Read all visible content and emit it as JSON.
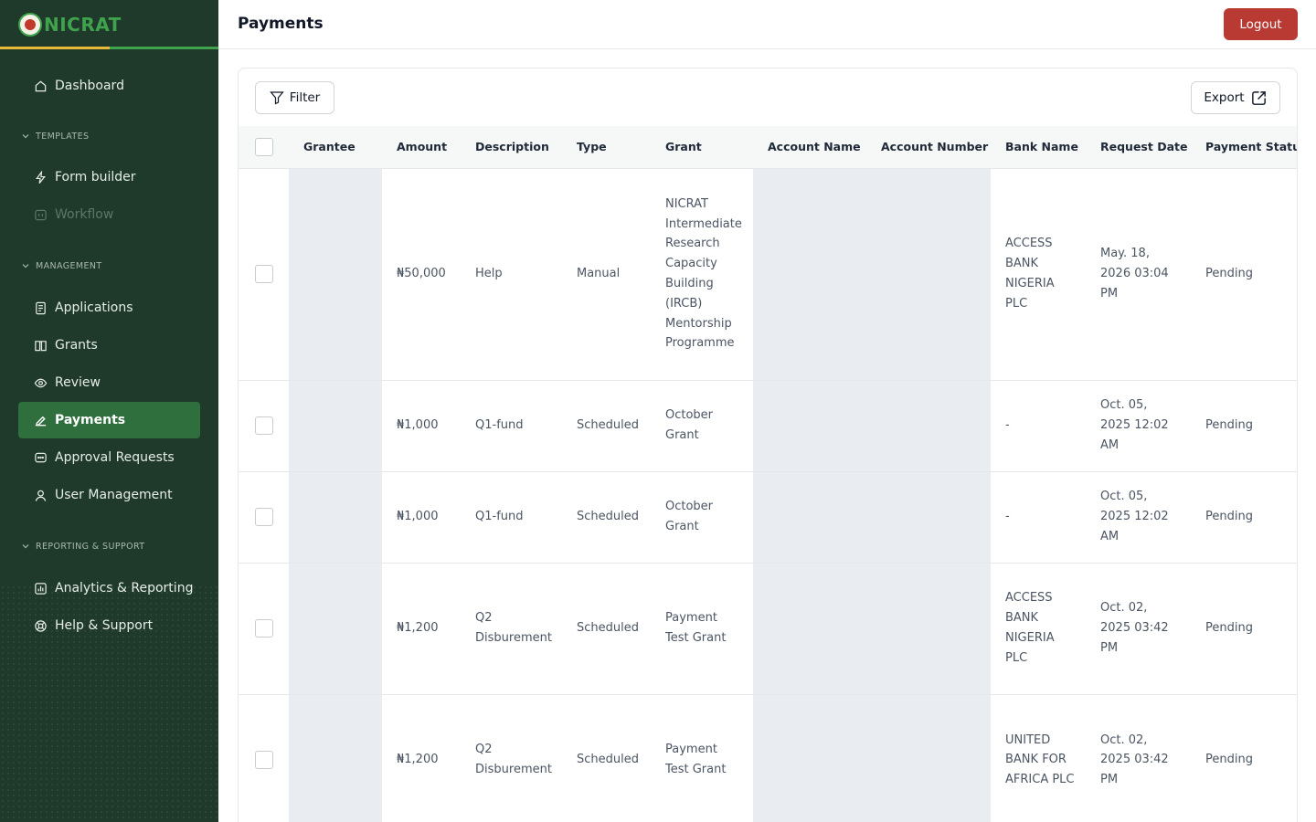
{
  "brand": {
    "name": "NICRAT"
  },
  "sidebar": {
    "dashboard": "Dashboard",
    "sections": {
      "templates": "TEMPLATES",
      "management": "MANAGEMENT",
      "reporting": "REPORTING & SUPPORT"
    },
    "items": {
      "form_builder": "Form builder",
      "workflow": "Workflow",
      "applications": "Applications",
      "grants": "Grants",
      "review": "Review",
      "payments": "Payments",
      "approval_requests": "Approval Requests",
      "user_management": "User Management",
      "analytics": "Analytics & Reporting",
      "help": "Help & Support"
    }
  },
  "header": {
    "title": "Payments",
    "logout_label": "Logout"
  },
  "toolbar": {
    "filter_label": "Filter",
    "export_label": "Export"
  },
  "table": {
    "columns": [
      "Grantee",
      "Amount",
      "Description",
      "Type",
      "Grant",
      "Account Name",
      "Account Number",
      "Bank Name",
      "Request Date",
      "Payment Status"
    ],
    "rows": [
      {
        "grantee": "",
        "amount": "₦50,000",
        "description": "Help",
        "type": "Manual",
        "grant": "NICRAT Intermediate Research Capacity Building (IRCB) Mentorship Programme",
        "account_name": "",
        "account_number": "",
        "bank_name": "ACCESS BANK NIGERIA PLC",
        "request_date": "May. 18, 2026 03:04 PM",
        "status": "Pending"
      },
      {
        "grantee": "",
        "amount": "₦1,000",
        "description": "Q1-fund",
        "type": "Scheduled",
        "grant": "October Grant",
        "account_name": "",
        "account_number": "",
        "bank_name": "-",
        "request_date": "Oct. 05, 2025 12:02 AM",
        "status": "Pending"
      },
      {
        "grantee": "",
        "amount": "₦1,000",
        "description": "Q1-fund",
        "type": "Scheduled",
        "grant": "October Grant",
        "account_name": "",
        "account_number": "",
        "bank_name": "-",
        "request_date": "Oct. 05, 2025 12:02 AM",
        "status": "Pending"
      },
      {
        "grantee": "",
        "amount": "₦1,200",
        "description": "Q2 Disburement",
        "type": "Scheduled",
        "grant": "Payment Test Grant",
        "account_name": "",
        "account_number": "",
        "bank_name": "ACCESS BANK NIGERIA PLC",
        "request_date": "Oct. 02, 2025 03:42 PM",
        "status": "Pending"
      },
      {
        "grantee": "",
        "amount": "₦1,200",
        "description": "Q2 Disburement",
        "type": "Scheduled",
        "grant": "Payment Test Grant",
        "account_name": "",
        "account_number": "",
        "bank_name": "UNITED BANK FOR AFRICA PLC",
        "request_date": "Oct. 02, 2025 03:42 PM",
        "status": "Pending"
      }
    ]
  },
  "icons": {
    "logo": "nicrat-logo-icon",
    "dashboard": "home-icon",
    "form_builder": "lightning-icon",
    "workflow": "workflow-icon",
    "applications": "document-icon",
    "grants": "book-icon",
    "review": "eye-icon",
    "payments": "payment-icon",
    "approval_requests": "chat-icon",
    "user_management": "user-icon",
    "analytics": "chart-icon",
    "help": "help-icon",
    "filter": "filter-icon",
    "export": "external-link-icon"
  },
  "colors": {
    "sidebar_bg": "#1f3a2b",
    "active_item": "#2f6f3d",
    "logout_bg": "#b93a32",
    "brand_green": "#3fa34d",
    "brand_accent": "#e5b93a"
  }
}
